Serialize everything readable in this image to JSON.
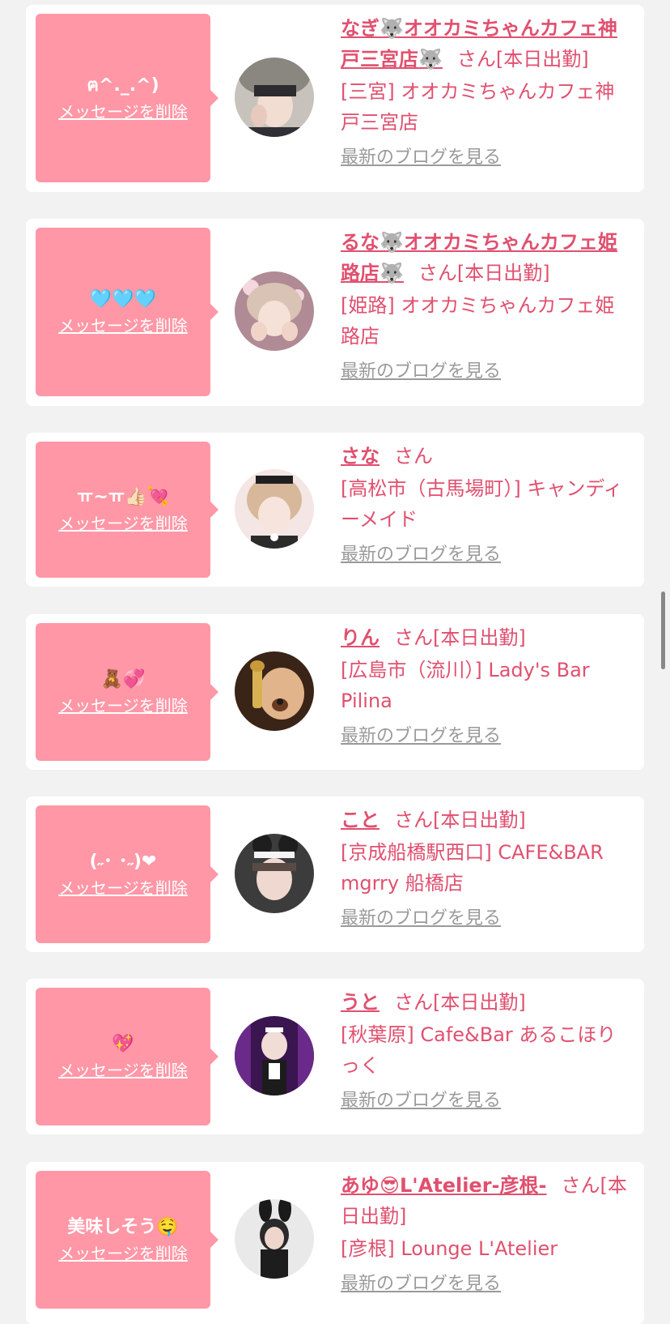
{
  "delete_label": "メッセージを削除",
  "blog_label": "最新のブログを見る",
  "honorific": "さん",
  "accent_color": "#ff97a6",
  "text_color": "#e0506f",
  "cards": [
    {
      "message": "ฅ^._.^)",
      "name": "なぎ🐺オオカミちゃんカフェ神戸三宮店🐺",
      "status": "[本日出勤]",
      "shop": "[三宮] オオカミちゃんカフェ神戸三宮店"
    },
    {
      "message": "🩵🩵🩵",
      "name": "るな🐺オオカミちゃんカフェ姫路店🐺",
      "status": "[本日出勤]",
      "shop": "[姫路] オオカミちゃんカフェ姫路店"
    },
    {
      "message": "ㅠ~ㅠ👍🏻💘",
      "name": "さな",
      "status": "",
      "shop": "[高松市（古馬場町）] キャンディーメイド"
    },
    {
      "message": "🧸💞",
      "name": "りん",
      "status": "[本日出勤]",
      "shop": "[広島市（流川）] Lady's Bar Pilina"
    },
    {
      "message": "(˶･ ･˶)❤",
      "name": "こと",
      "status": "[本日出勤]",
      "shop": "[京成船橋駅西口] CAFE&BAR mgrry 船橋店"
    },
    {
      "message": "💖",
      "name": "うと",
      "status": "[本日出勤]",
      "shop": "[秋葉原] Cafe&Bar あるこほりっく"
    },
    {
      "message": "美味しそう🤤",
      "name": "あゆ😎L'Atelier-彦根-",
      "status": "[本日出勤]",
      "shop": "[彦根] Lounge L'Atelier"
    }
  ]
}
